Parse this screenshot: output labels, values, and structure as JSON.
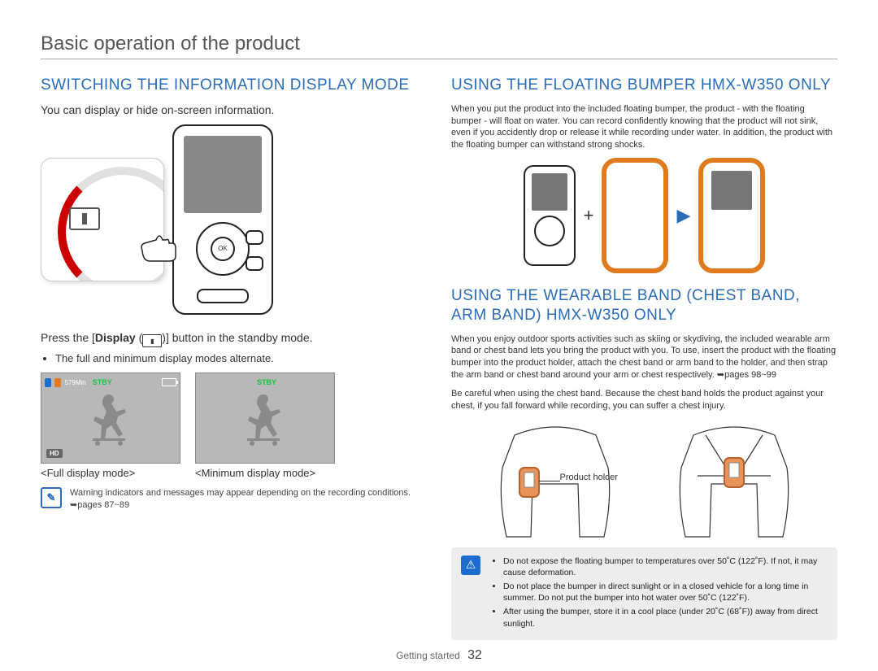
{
  "page_title": "Basic operation of the product",
  "footer": {
    "section": "Getting started",
    "page_number": "32"
  },
  "left": {
    "heading": "SWITCHING THE INFORMATION DISPLAY MODE",
    "intro": "You can display or hide on-screen information.",
    "instruction_prefix": "Press the [",
    "instruction_bold": "Display",
    "instruction_mid": " (",
    "instruction_suffix": ")] button in the standby mode.",
    "bullets": [
      "The full and minimum display modes alternate."
    ],
    "screens": {
      "full": {
        "chip1": "",
        "chip2_text": "579Min",
        "stby": "STBY",
        "hd": "HD",
        "caption": "<Full display mode>"
      },
      "min": {
        "stby": "STBY",
        "caption": "<Minimum display mode>"
      }
    },
    "note": "Warning indicators and messages may appear depending on the recording conditions. ➥pages 87~89"
  },
  "right": {
    "heading1": "USING THE FLOATING BUMPER HMX-W350 ONLY",
    "body1": "When you put the product into the included floating bumper, the product - with the floating bumper - will float on water. You can record confidently knowing that the product will not sink, even if you accidently drop or release it while recording under water. In addition, the product with the floating bumper can withstand strong shocks.",
    "heading2": "USING THE WEARABLE BAND (CHEST BAND, ARM BAND) HMX-W350 ONLY",
    "body2a": "When you enjoy outdoor sports activities such as skiing or skydiving, the included wearable arm band or chest band lets you bring the product with you. To use, insert the product with the floating bumper into the product holder, attach the chest band or arm band to the holder, and then strap the arm band or chest band around your arm or chest respectively. ➥pages 98~99",
    "body2b": "Be careful when using the chest band. Because the chest band holds the product against your chest, if you fall forward while recording, you can suffer a chest injury.",
    "annotation": "Product holder",
    "caution": [
      "Do not expose the floating bumper to temperatures over 50˚C (122˚F). If not, it may cause deformation.",
      "Do not place the bumper in direct sunlight or in a closed vehicle for a long time in summer. Do not put the bumper into hot water over 50˚C (122˚F).",
      "After using the bumper, store it in a cool place (under 20˚C (68˚F)) away from direct sunlight."
    ]
  },
  "icons": {
    "display_icon": "display-mode-icon",
    "note_icon": "note-icon",
    "caution_icon": "caution-triangle-icon",
    "arrow": "arrow-right-icon",
    "plus": "plus-icon"
  }
}
